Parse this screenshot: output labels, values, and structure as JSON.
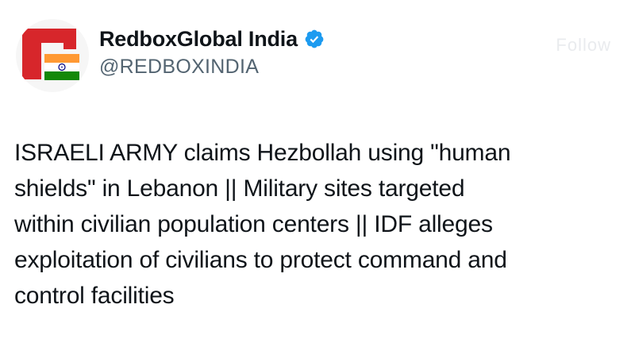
{
  "tweet": {
    "author": {
      "display_name": "RedboxGlobal India",
      "handle": "@REDBOXINDIA",
      "verified": true,
      "verified_color": "#1d9bf0"
    },
    "menu_label": "Follow",
    "text_lines": [
      "ISRAELI ARMY claims Hezbollah using \"human",
      "shields\" in Lebanon || Military sites targeted",
      "within civilian population centers || IDF alleges",
      "exploitation of civilians to protect command and",
      "control facilities"
    ]
  },
  "colors": {
    "brand_red": "#d7262b",
    "saffron": "#ff9933",
    "india_green": "#138808",
    "chakra_blue": "#000080",
    "handle_gray": "#536471"
  },
  "icons": {
    "verified": "verified-badge-icon",
    "avatar": "redbox-india-logo"
  }
}
